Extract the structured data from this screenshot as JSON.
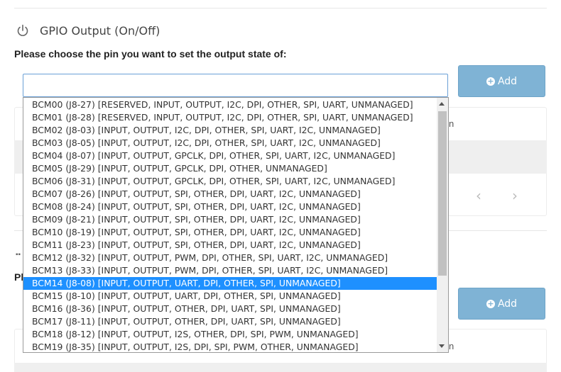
{
  "section": {
    "title": "GPIO Output (On/Off)",
    "prompt": "Please choose the pin you want to set the output state of:",
    "icon": "power-icon"
  },
  "select": {
    "value": ""
  },
  "buttons": {
    "add_label": "Add"
  },
  "background": {
    "frag_n1": "n",
    "frag_n2": "n",
    "frag_pl": "Pl"
  },
  "dropdown": {
    "selected_index": 14,
    "options": [
      "BCM00 (J8-27) [RESERVED, INPUT, OUTPUT, I2C, DPI, OTHER, SPI, UART, UNMANAGED]",
      "BCM01 (J8-28) [RESERVED, INPUT, OUTPUT, I2C, DPI, OTHER, SPI, UART, UNMANAGED]",
      "BCM02 (J8-03) [INPUT, OUTPUT, I2C, DPI, OTHER, SPI, UART, I2C, UNMANAGED]",
      "BCM03 (J8-05) [INPUT, OUTPUT, I2C, DPI, OTHER, SPI, UART, I2C, UNMANAGED]",
      "BCM04 (J8-07) [INPUT, OUTPUT, GPCLK, DPI, OTHER, SPI, UART, I2C, UNMANAGED]",
      "BCM05 (J8-29) [INPUT, OUTPUT, GPCLK, DPI, OTHER, UNMANAGED]",
      "BCM06 (J8-31) [INPUT, OUTPUT, GPCLK, DPI, OTHER, SPI, UART, I2C, UNMANAGED]",
      "BCM07 (J8-26) [INPUT, OUTPUT, SPI, OTHER, DPI, UART, I2C, UNMANAGED]",
      "BCM08 (J8-24) [INPUT, OUTPUT, SPI, OTHER, DPI, UART, I2C, UNMANAGED]",
      "BCM09 (J8-21) [INPUT, OUTPUT, SPI, OTHER, DPI, UART, I2C, UNMANAGED]",
      "BCM10 (J8-19) [INPUT, OUTPUT, SPI, OTHER, DPI, UART, I2C, UNMANAGED]",
      "BCM11 (J8-23) [INPUT, OUTPUT, SPI, OTHER, DPI, UART, I2C, UNMANAGED]",
      "BCM12 (J8-32) [INPUT, OUTPUT, PWM, DPI, OTHER, SPI, UART, I2C, UNMANAGED]",
      "BCM13 (J8-33) [INPUT, OUTPUT, PWM, DPI, OTHER, SPI, UART, I2C, UNMANAGED]",
      "BCM14 (J8-08) [INPUT, OUTPUT, UART, DPI, OTHER, SPI, UNMANAGED]",
      "BCM15 (J8-10) [INPUT, OUTPUT, UART, DPI, OTHER, SPI, UNMANAGED]",
      "BCM16 (J8-36) [INPUT, OUTPUT, OTHER, DPI, UART, SPI, UNMANAGED]",
      "BCM17 (J8-11) [INPUT, OUTPUT, OTHER, DPI, UART, SPI, UNMANAGED]",
      "BCM18 (J8-12) [INPUT, OUTPUT, I2S, OTHER, DPI, SPI, PWM, UNMANAGED]",
      "BCM19 (J8-35) [INPUT, OUTPUT, I2S, DPI, SPI, PWM, OTHER, UNMANAGED]"
    ]
  },
  "colors": {
    "accent": "#1e90ff",
    "add_button": "#7fb3d5",
    "select_border": "#6aa0d6"
  }
}
